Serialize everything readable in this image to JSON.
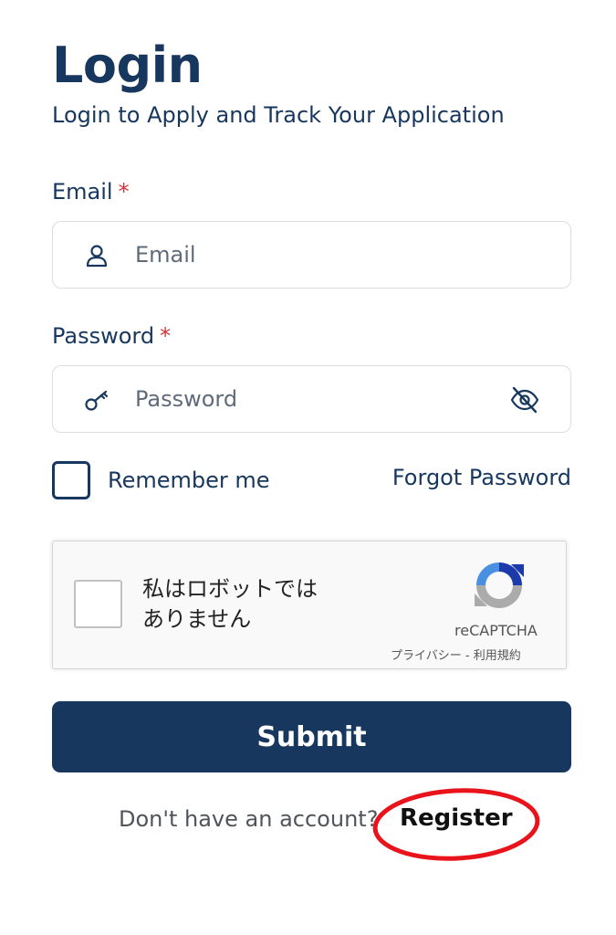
{
  "header": {
    "title": "Login",
    "subtitle": "Login to Apply and Track Your Application"
  },
  "email": {
    "label": "Email",
    "required_mark": "*",
    "placeholder": "Email",
    "value": "",
    "icon": "user-icon"
  },
  "password": {
    "label": "Password",
    "required_mark": "*",
    "placeholder": "Password",
    "value": "",
    "icon": "key-icon",
    "toggle_icon": "eye-off-icon"
  },
  "remember_me": {
    "label": "Remember me",
    "checked": false
  },
  "forgot_password": {
    "label": "Forgot Password"
  },
  "recaptcha": {
    "label_line1": "私はロボットでは",
    "label_line2": "ありません",
    "brand": "reCAPTCHA",
    "links": "プライバシー - 利用規約"
  },
  "submit": {
    "label": "Submit"
  },
  "footer": {
    "prompt": "Don't have an account?",
    "register_label": "Register",
    "highlight_color": "#e8131b"
  },
  "colors": {
    "primary": "#17375e",
    "required": "#d0343a"
  }
}
